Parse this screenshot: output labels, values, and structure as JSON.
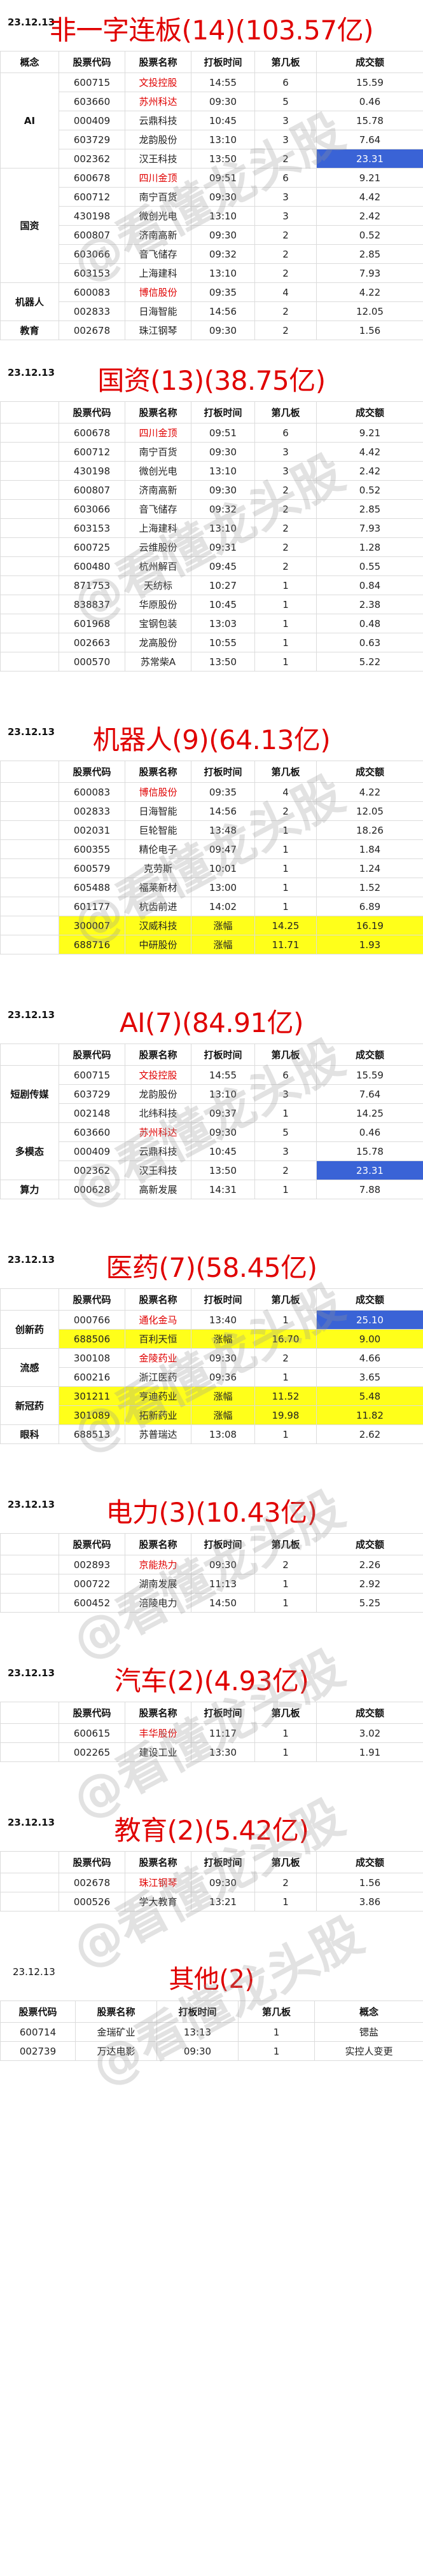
{
  "sections": [
    {
      "date": "23.12.13",
      "title": "非一字连板(14)(103.57亿)",
      "headers": [
        "概念",
        "股票代码",
        "股票名称",
        "打板时间",
        "第几板",
        "成交额"
      ],
      "rows": [
        {
          "cat": "AI",
          "code": "600715",
          "name": "文投控股",
          "time": "14:55",
          "board": "6",
          "amount": "15.59",
          "nameRed": true
        },
        {
          "cat": "",
          "code": "603660",
          "name": "苏州科达",
          "time": "09:30",
          "board": "5",
          "amount": "0.46",
          "nameRed": true
        },
        {
          "cat": "",
          "code": "000409",
          "name": "云鼎科技",
          "time": "10:45",
          "board": "3",
          "amount": "15.78"
        },
        {
          "cat": "",
          "code": "603729",
          "name": "龙韵股份",
          "time": "13:10",
          "board": "3",
          "amount": "7.64"
        },
        {
          "cat": "",
          "code": "002362",
          "name": "汉王科技",
          "time": "13:50",
          "board": "2",
          "amount": "23.31",
          "amountBlue": true
        },
        {
          "cat": "国资",
          "code": "600678",
          "name": "四川金顶",
          "time": "09:51",
          "board": "6",
          "amount": "9.21",
          "nameRed": true
        },
        {
          "cat": "",
          "code": "600712",
          "name": "南宁百货",
          "time": "09:30",
          "board": "3",
          "amount": "4.42"
        },
        {
          "cat": "",
          "code": "430198",
          "name": "微创光电",
          "time": "13:10",
          "board": "3",
          "amount": "2.42"
        },
        {
          "cat": "",
          "code": "600807",
          "name": "济南高新",
          "time": "09:30",
          "board": "2",
          "amount": "0.52"
        },
        {
          "cat": "",
          "code": "603066",
          "name": "音飞储存",
          "time": "09:32",
          "board": "2",
          "amount": "2.85"
        },
        {
          "cat": "",
          "code": "603153",
          "name": "上海建科",
          "time": "13:10",
          "board": "2",
          "amount": "7.93"
        },
        {
          "cat": "机器人",
          "code": "600083",
          "name": "博信股份",
          "time": "09:35",
          "board": "4",
          "amount": "4.22",
          "nameRed": true
        },
        {
          "cat": "",
          "code": "002833",
          "name": "日海智能",
          "time": "14:56",
          "board": "2",
          "amount": "12.05"
        },
        {
          "cat": "教育",
          "code": "002678",
          "name": "珠江钢琴",
          "time": "09:30",
          "board": "2",
          "amount": "1.56"
        }
      ],
      "catBlocks": [
        [
          0,
          4
        ],
        [
          5,
          10
        ],
        [
          11,
          12
        ],
        [
          13,
          13
        ]
      ]
    },
    {
      "date": "23.12.13",
      "title": "国资(13)(38.75亿)",
      "headers": [
        "",
        "股票代码",
        "股票名称",
        "打板时间",
        "第几板",
        "成交额"
      ],
      "rows": [
        {
          "code": "600678",
          "name": "四川金顶",
          "time": "09:51",
          "board": "6",
          "amount": "9.21",
          "nameRed": true
        },
        {
          "code": "600712",
          "name": "南宁百货",
          "time": "09:30",
          "board": "3",
          "amount": "4.42"
        },
        {
          "code": "430198",
          "name": "微创光电",
          "time": "13:10",
          "board": "3",
          "amount": "2.42"
        },
        {
          "code": "600807",
          "name": "济南高新",
          "time": "09:30",
          "board": "2",
          "amount": "0.52"
        },
        {
          "code": "603066",
          "name": "音飞储存",
          "time": "09:32",
          "board": "2",
          "amount": "2.85"
        },
        {
          "code": "603153",
          "name": "上海建科",
          "time": "13:10",
          "board": "2",
          "amount": "7.93"
        },
        {
          "code": "600725",
          "name": "云维股份",
          "time": "09:31",
          "board": "2",
          "amount": "1.28"
        },
        {
          "code": "600480",
          "name": "杭州解百",
          "time": "09:45",
          "board": "2",
          "amount": "0.55"
        },
        {
          "code": "871753",
          "name": "天纺标",
          "time": "10:27",
          "board": "1",
          "amount": "0.84"
        },
        {
          "code": "838837",
          "name": "华原股份",
          "time": "10:45",
          "board": "1",
          "amount": "2.38"
        },
        {
          "code": "601968",
          "name": "宝钢包装",
          "time": "13:03",
          "board": "1",
          "amount": "0.48"
        },
        {
          "code": "002663",
          "name": "龙高股份",
          "time": "10:55",
          "board": "1",
          "amount": "0.63"
        },
        {
          "code": "000570",
          "name": "苏常柴A",
          "time": "13:50",
          "board": "1",
          "amount": "5.22"
        }
      ]
    },
    {
      "date": "23.12.13",
      "title": "机器人(9)(64.13亿)",
      "headers": [
        "",
        "股票代码",
        "股票名称",
        "打板时间",
        "第几板",
        "成交额"
      ],
      "rows": [
        {
          "code": "600083",
          "name": "博信股份",
          "time": "09:35",
          "board": "4",
          "amount": "4.22",
          "nameRed": true
        },
        {
          "code": "002833",
          "name": "日海智能",
          "time": "14:56",
          "board": "2",
          "amount": "12.05"
        },
        {
          "code": "002031",
          "name": "巨轮智能",
          "time": "13:48",
          "board": "1",
          "amount": "18.26"
        },
        {
          "code": "600355",
          "name": "精伦电子",
          "time": "09:47",
          "board": "1",
          "amount": "1.84"
        },
        {
          "code": "600579",
          "name": "克劳斯",
          "time": "10:01",
          "board": "1",
          "amount": "1.24"
        },
        {
          "code": "605488",
          "name": "福莱新材",
          "time": "13:00",
          "board": "1",
          "amount": "1.52"
        },
        {
          "code": "601177",
          "name": "杭齿前进",
          "time": "14:02",
          "board": "1",
          "amount": "6.89"
        },
        {
          "code": "300007",
          "name": "汉威科技",
          "time": "涨幅",
          "board": "14.25",
          "amount": "16.19",
          "yellow": true
        },
        {
          "code": "688716",
          "name": "中研股份",
          "time": "涨幅",
          "board": "11.71",
          "amount": "1.93",
          "yellow": true
        }
      ]
    },
    {
      "date": "23.12.13",
      "title": "AI(7)(84.91亿)",
      "headers": [
        "",
        "股票代码",
        "股票名称",
        "打板时间",
        "第几板",
        "成交额"
      ],
      "rows": [
        {
          "cat": "短剧传媒",
          "code": "600715",
          "name": "文投控股",
          "time": "14:55",
          "board": "6",
          "amount": "15.59",
          "nameRed": true
        },
        {
          "cat": "",
          "code": "603729",
          "name": "龙韵股份",
          "time": "13:10",
          "board": "3",
          "amount": "7.64"
        },
        {
          "cat": "",
          "code": "002148",
          "name": "北纬科技",
          "time": "09:37",
          "board": "1",
          "amount": "14.25"
        },
        {
          "cat": "多模态",
          "code": "603660",
          "name": "苏州科达",
          "time": "09:30",
          "board": "5",
          "amount": "0.46",
          "nameRed": true
        },
        {
          "cat": "",
          "code": "000409",
          "name": "云鼎科技",
          "time": "10:45",
          "board": "3",
          "amount": "15.78"
        },
        {
          "cat": "",
          "code": "002362",
          "name": "汉王科技",
          "time": "13:50",
          "board": "2",
          "amount": "23.31",
          "amountBlue": true
        },
        {
          "cat": "算力",
          "code": "000628",
          "name": "高新发展",
          "time": "14:31",
          "board": "1",
          "amount": "7.88"
        }
      ],
      "catBlocks": [
        [
          0,
          2
        ],
        [
          3,
          5
        ],
        [
          6,
          6
        ]
      ]
    },
    {
      "date": "23.12.13",
      "title": "医药(7)(58.45亿)",
      "headers": [
        "",
        "股票代码",
        "股票名称",
        "打板时间",
        "第几板",
        "成交额"
      ],
      "rows": [
        {
          "cat": "创新药",
          "code": "000766",
          "name": "通化金马",
          "time": "13:40",
          "board": "1",
          "amount": "25.10",
          "nameRed": true,
          "amountBlue": true
        },
        {
          "cat": "",
          "code": "688506",
          "name": "百利天恒",
          "time": "涨幅",
          "board": "16.70",
          "amount": "9.00",
          "yellow": true
        },
        {
          "cat": "流感",
          "code": "300108",
          "name": "金陵药业",
          "time": "09:30",
          "board": "2",
          "amount": "4.66",
          "nameRed": true
        },
        {
          "cat": "",
          "code": "600216",
          "name": "浙江医药",
          "time": "09:36",
          "board": "1",
          "amount": "3.65"
        },
        {
          "cat": "新冠药",
          "code": "301211",
          "name": "亨迪药业",
          "time": "涨幅",
          "board": "11.52",
          "amount": "5.48",
          "yellow": true
        },
        {
          "cat": "",
          "code": "301089",
          "name": "拓新药业",
          "time": "涨幅",
          "board": "19.98",
          "amount": "11.82",
          "yellow": true
        },
        {
          "cat": "眼科",
          "code": "688513",
          "name": "苏普瑞达",
          "time": "13:08",
          "board": "1",
          "amount": "2.62"
        }
      ],
      "catBlocks": [
        [
          0,
          1
        ],
        [
          2,
          3
        ],
        [
          4,
          5
        ],
        [
          6,
          6
        ]
      ]
    },
    {
      "date": "23.12.13",
      "title": "电力(3)(10.43亿)",
      "headers": [
        "",
        "股票代码",
        "股票名称",
        "打板时间",
        "第几板",
        "成交额"
      ],
      "rows": [
        {
          "code": "002893",
          "name": "京能热力",
          "time": "09:30",
          "board": "2",
          "amount": "2.26",
          "nameRed": true
        },
        {
          "code": "000722",
          "name": "湖南发展",
          "time": "11:13",
          "board": "1",
          "amount": "2.92"
        },
        {
          "code": "600452",
          "name": "涪陵电力",
          "time": "14:50",
          "board": "1",
          "amount": "5.25"
        }
      ]
    },
    {
      "date": "23.12.13",
      "title": "汽车(2)(4.93亿)",
      "headers": [
        "",
        "股票代码",
        "股票名称",
        "打板时间",
        "第几板",
        "成交额"
      ],
      "rows": [
        {
          "code": "600615",
          "name": "丰华股份",
          "time": "11:17",
          "board": "1",
          "amount": "3.02",
          "nameRed": true
        },
        {
          "code": "002265",
          "name": "建设工业",
          "time": "13:30",
          "board": "1",
          "amount": "1.91"
        }
      ]
    },
    {
      "date": "23.12.13",
      "title": "教育(2)(5.42亿)",
      "headers": [
        "",
        "股票代码",
        "股票名称",
        "打板时间",
        "第几板",
        "成交额"
      ],
      "rows": [
        {
          "code": "002678",
          "name": "珠江钢琴",
          "time": "09:30",
          "board": "2",
          "amount": "1.56",
          "nameRed": true
        },
        {
          "code": "000526",
          "name": "学大教育",
          "time": "13:21",
          "board": "1",
          "amount": "3.86"
        }
      ]
    }
  ],
  "other": {
    "date": "23.12.13",
    "title": "其他(2)",
    "headers": [
      "股票代码",
      "股票名称",
      "打板时间",
      "第几板",
      "概念"
    ],
    "rows": [
      {
        "code": "600714",
        "name": "金瑞矿业",
        "time": "13:13",
        "board": "1",
        "concept": "锶盐"
      },
      {
        "code": "002739",
        "name": "万达电影",
        "time": "09:30",
        "board": "1",
        "concept": "实控人变更"
      }
    ]
  },
  "watermark": "@看懂龙头股"
}
